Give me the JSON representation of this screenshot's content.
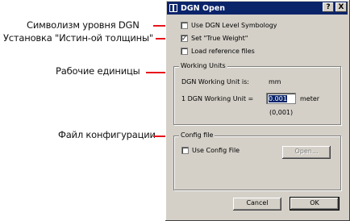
{
  "annotations": {
    "level_symbology": "Символизм уровня DGN",
    "true_weight": "Установка \"Истин-ой толщины\"",
    "working_units": "Рабочие единицы",
    "config_file": "Файл конфигурации"
  },
  "window": {
    "title": "DGN Open",
    "help_label": "?",
    "close_label": "X"
  },
  "options": {
    "use_level_symbology": {
      "label": "Use DGN Level Symbology",
      "checked": false
    },
    "true_weight": {
      "label": "Set \"True Weight\"",
      "checked": true
    },
    "load_reference_files": {
      "label": "Load reference files",
      "checked": false
    }
  },
  "working_units": {
    "title": "Working Units",
    "dgn_unit_label": "DGN Working Unit is:",
    "dgn_unit_value": "mm",
    "equation_label": "1 DGN Working Unit =",
    "input_value": "0.001",
    "unit_name": "meter",
    "hint": "(0,001)"
  },
  "config_file": {
    "title": "Config file",
    "use_label": "Use Config File",
    "checked": false,
    "open_label": "Open..."
  },
  "buttons": {
    "cancel": "Cancel",
    "ok": "OK"
  },
  "colors": {
    "titlebar": "#0a246a",
    "arrow": "#e8141b",
    "dialog_bg": "#d4d0c8"
  }
}
